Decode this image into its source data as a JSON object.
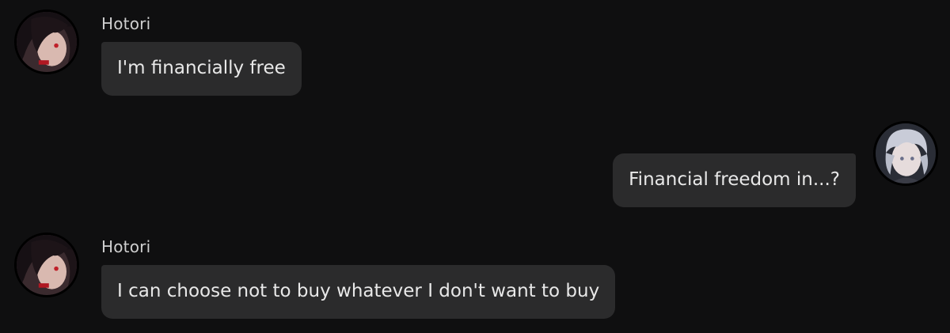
{
  "messages": [
    {
      "sender": "Hotori",
      "text": "I'm financially free",
      "side": "left",
      "avatar_icon": "hotori-avatar-icon"
    },
    {
      "sender": "",
      "text": "Financial freedom in...?",
      "side": "right",
      "avatar_icon": "user-avatar-icon"
    },
    {
      "sender": "Hotori",
      "text": "I can choose not to buy whatever I don't want to buy",
      "side": "left",
      "avatar_icon": "hotori-avatar-icon"
    }
  ],
  "colors": {
    "background": "#0f0f10",
    "bubble": "#2b2b2c",
    "text": "#e8e8e8",
    "sender": "#cfcfcf"
  }
}
